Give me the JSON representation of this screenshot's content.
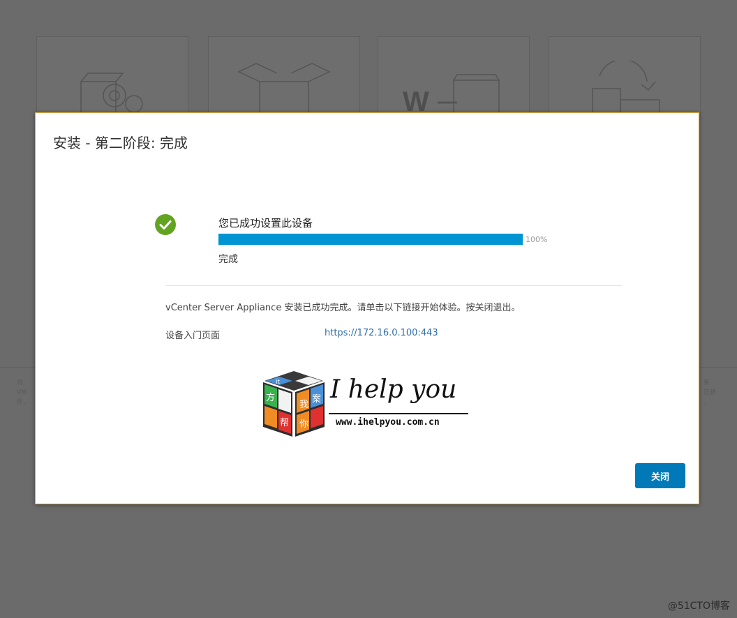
{
  "background": {
    "cards": [
      {
        "icon": "install-gear-icon"
      },
      {
        "icon": "open-box-icon"
      },
      {
        "icon": "migrate-icon"
      },
      {
        "icon": "restore-icon"
      }
    ],
    "left_snippet": "说\nVM\n件，",
    "right_snippet": "条\n迁移\n，"
  },
  "modal": {
    "title": "安装 - 第二阶段: 完成",
    "status_heading": "您已成功设置此设备",
    "progress_fraction": 1.0,
    "progress_text": "100%",
    "status_sub": "完成",
    "message": "vCenter Server Appliance 安装已成功完成。请单击以下链接开始体验。按关闭退出。",
    "link_label": "设备入门页面",
    "link_url": "https://172.16.0.100:443",
    "close_label": "关闭",
    "accent_color": "#0079b8",
    "success_color": "#62a420"
  },
  "watermark": {
    "title": "I help you",
    "url": "www.ihelpyou.com.cn",
    "cube_chars": [
      "it",
      "",
      "方",
      "案",
      "我",
      "帮",
      "你"
    ]
  },
  "corner_mark": "@51CTO博客"
}
